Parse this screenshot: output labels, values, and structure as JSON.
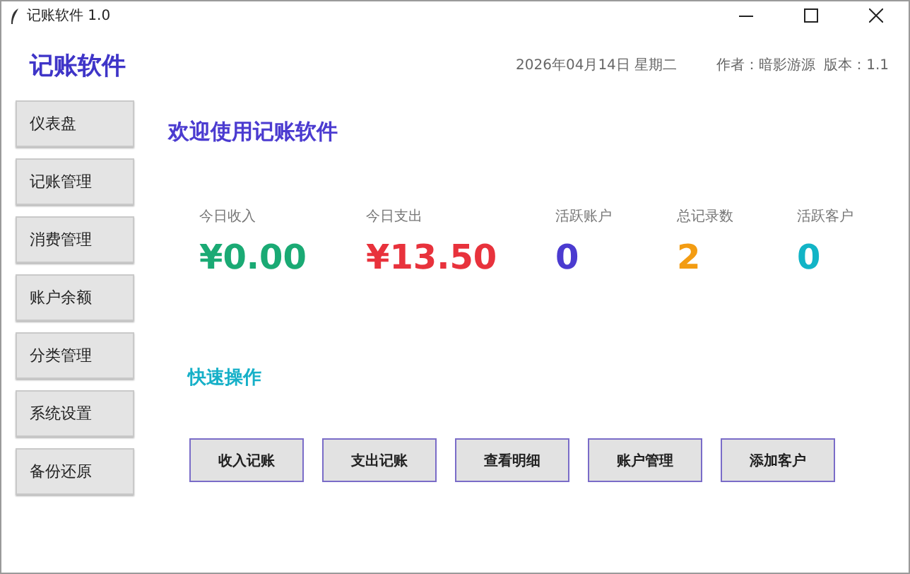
{
  "window": {
    "title": "记账软件 1.0"
  },
  "header": {
    "app_name": "记账软件",
    "date": "2026年04月14日 星期二",
    "author": "作者：暗影游源",
    "version": "版本：1.1"
  },
  "sidebar": {
    "items": [
      {
        "label": "仪表盘"
      },
      {
        "label": "记账管理"
      },
      {
        "label": "消费管理"
      },
      {
        "label": "账户余额"
      },
      {
        "label": "分类管理"
      },
      {
        "label": "系统设置"
      },
      {
        "label": "备份还原"
      }
    ]
  },
  "main": {
    "welcome": "欢迎使用记账软件",
    "stats": [
      {
        "label": "今日收入",
        "value": "¥0.00",
        "color": "#1aaa74"
      },
      {
        "label": "今日支出",
        "value": "¥13.50",
        "color": "#e8323c"
      },
      {
        "label": "活跃账户",
        "value": "0",
        "color": "#4b3bd0"
      },
      {
        "label": "总记录数",
        "value": "2",
        "color": "#f39c12"
      },
      {
        "label": "活跃客户",
        "value": "0",
        "color": "#12b4c6"
      }
    ],
    "quick_title": "快速操作",
    "quick_buttons": [
      "收入记账",
      "支出记账",
      "查看明细",
      "账户管理",
      "添加客户"
    ]
  }
}
